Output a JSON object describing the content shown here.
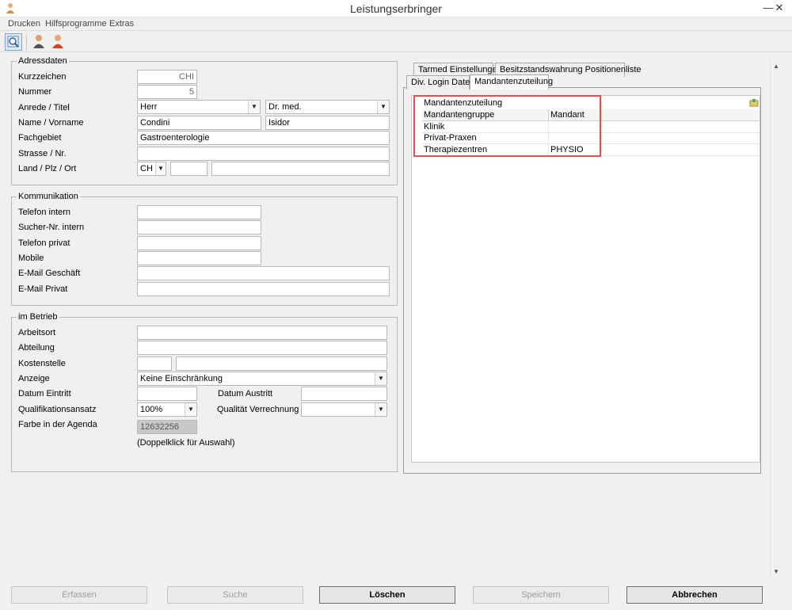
{
  "window": {
    "title": "Leistungserbringer",
    "minimize": "—",
    "close": "✕"
  },
  "menu": [
    "Drucken",
    "Hilfsprogramme",
    "Extras"
  ],
  "adressdaten": {
    "legend": "Adressdaten",
    "kurzzeichen_label": "Kurzzeichen",
    "kurzzeichen": "CHI",
    "nummer_label": "Nummer",
    "nummer": "5",
    "anrede_label": "Anrede / Titel",
    "anrede": "Herr",
    "titel": "Dr. med.",
    "name_label": "Name / Vorname",
    "name": "Condini",
    "vorname": "Isidor",
    "fachgebiet_label": "Fachgebiet",
    "fachgebiet": "Gastroenterologie",
    "strasse_label": "Strasse / Nr.",
    "land_label": "Land / Plz / Ort",
    "land": "CH"
  },
  "kommunikation": {
    "legend": "Kommunikation",
    "telefon_intern": "Telefon intern",
    "sucher": "Sucher-Nr. intern",
    "telefon_privat": "Telefon privat",
    "mobile": "Mobile",
    "email_geschaeft": "E-Mail Geschäft",
    "email_privat": "E-Mail Privat"
  },
  "betrieb": {
    "legend": "im Betrieb",
    "arbeitsort": "Arbeitsort",
    "abteilung": "Abteilung",
    "kostenstelle": "Kostenstelle",
    "anzeige_label": "Anzeige",
    "anzeige": "Keine Einschränkung",
    "datum_eintritt": "Datum Eintritt",
    "datum_austritt": "Datum Austritt",
    "qualifikation_label": "Qualifikationsansatz",
    "qualifikation": "100%",
    "qualitaet_label": "Qualität Verrechnung",
    "farbe_label": "Farbe in der Agenda",
    "farbe": "12632256",
    "farbe_hint": "(Doppelklick für Auswahl)"
  },
  "tabs": {
    "row1": [
      "Tarmed Einstellungen",
      "Besitzstandswahrung Positionenliste"
    ],
    "row2": [
      "Div. Login Daten",
      "Mandantenzuteilung"
    ]
  },
  "mandanten": {
    "title": "Mandantenzuteilung",
    "columns": [
      "Mandantengruppe",
      "Mandant"
    ],
    "rows": [
      {
        "gruppe": "Klinik",
        "mandant": ""
      },
      {
        "gruppe": "Privat-Praxen",
        "mandant": ""
      },
      {
        "gruppe": "Therapiezentren",
        "mandant": "PHYSIO"
      }
    ]
  },
  "buttons": {
    "erfassen": "Erfassen",
    "suche": "Suche",
    "loeschen": "Löschen",
    "speichern": "Speichern",
    "abbrechen": "Abbrechen"
  },
  "colors": {
    "highlight": "#d9534f"
  }
}
